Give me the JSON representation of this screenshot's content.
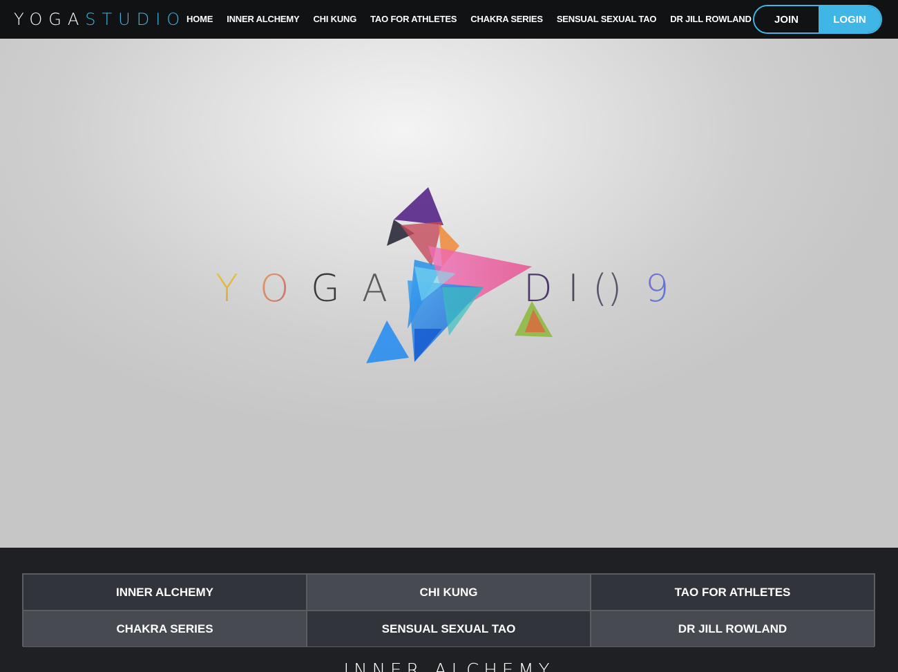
{
  "brand": {
    "logo_part1": "YOGA",
    "logo_part2": "STUDIO",
    "logo_color_primary": "#ffffff",
    "logo_color_accent": "#3fb6e6"
  },
  "nav": {
    "items": [
      {
        "label": "HOME"
      },
      {
        "label": "INNER ALCHEMY"
      },
      {
        "label": "CHI KUNG"
      },
      {
        "label": "TAO FOR ATHLETES"
      },
      {
        "label": "CHAKRA SERIES"
      },
      {
        "label": "SENSUAL SEXUAL TAO"
      },
      {
        "label": "DR JILL ROWLAND"
      }
    ],
    "join_label": "JOIN",
    "login_label": "LOGIN"
  },
  "hero": {
    "video_logo_text": "YOGA STUDIO 9"
  },
  "categories": [
    {
      "label": "INNER ALCHEMY"
    },
    {
      "label": "CHI KUNG"
    },
    {
      "label": "TAO FOR ATHLETES"
    },
    {
      "label": "CHAKRA SERIES"
    },
    {
      "label": "SENSUAL SEXUAL TAO"
    },
    {
      "label": "DR JILL ROWLAND"
    }
  ],
  "section": {
    "heading": "INNER ALCHEMY"
  },
  "colors": {
    "accent": "#3fb6e6",
    "nav_bg": "#111213",
    "lower_bg": "#1e2024"
  }
}
